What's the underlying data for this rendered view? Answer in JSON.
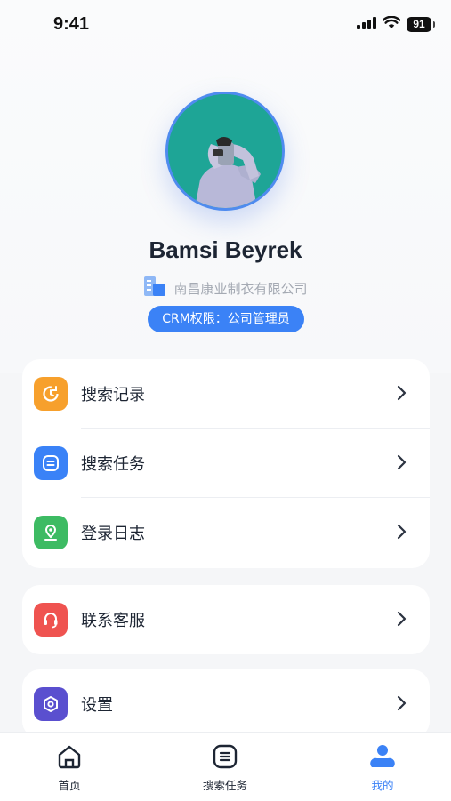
{
  "status_bar": {
    "time": "9:41",
    "battery": "91"
  },
  "profile": {
    "name": "Bamsi Beyrek",
    "company": "南昌康业制衣有限公司",
    "crm_role": "CRM权限：公司管理员"
  },
  "menu": {
    "group1": [
      {
        "label": "搜索记录",
        "icon": "search-history-icon",
        "color": "#f7a02c"
      },
      {
        "label": "搜索任务",
        "icon": "search-task-icon",
        "color": "#3a82f7"
      },
      {
        "label": "登录日志",
        "icon": "login-log-icon",
        "color": "#3dbb63"
      }
    ],
    "group2": [
      {
        "label": "联系客服",
        "icon": "customer-service-icon",
        "color": "#ef5350"
      }
    ],
    "group3": [
      {
        "label": "设置",
        "icon": "settings-icon",
        "color": "#5a4fcf"
      }
    ]
  },
  "tabs": [
    {
      "label": "首页",
      "icon": "home-icon",
      "active": false
    },
    {
      "label": "搜索任务",
      "icon": "task-icon",
      "active": false
    },
    {
      "label": "我的",
      "icon": "profile-icon",
      "active": true
    }
  ],
  "colors": {
    "accent": "#3b82f6",
    "text": "#1d2533",
    "muted": "#a5aab3"
  }
}
